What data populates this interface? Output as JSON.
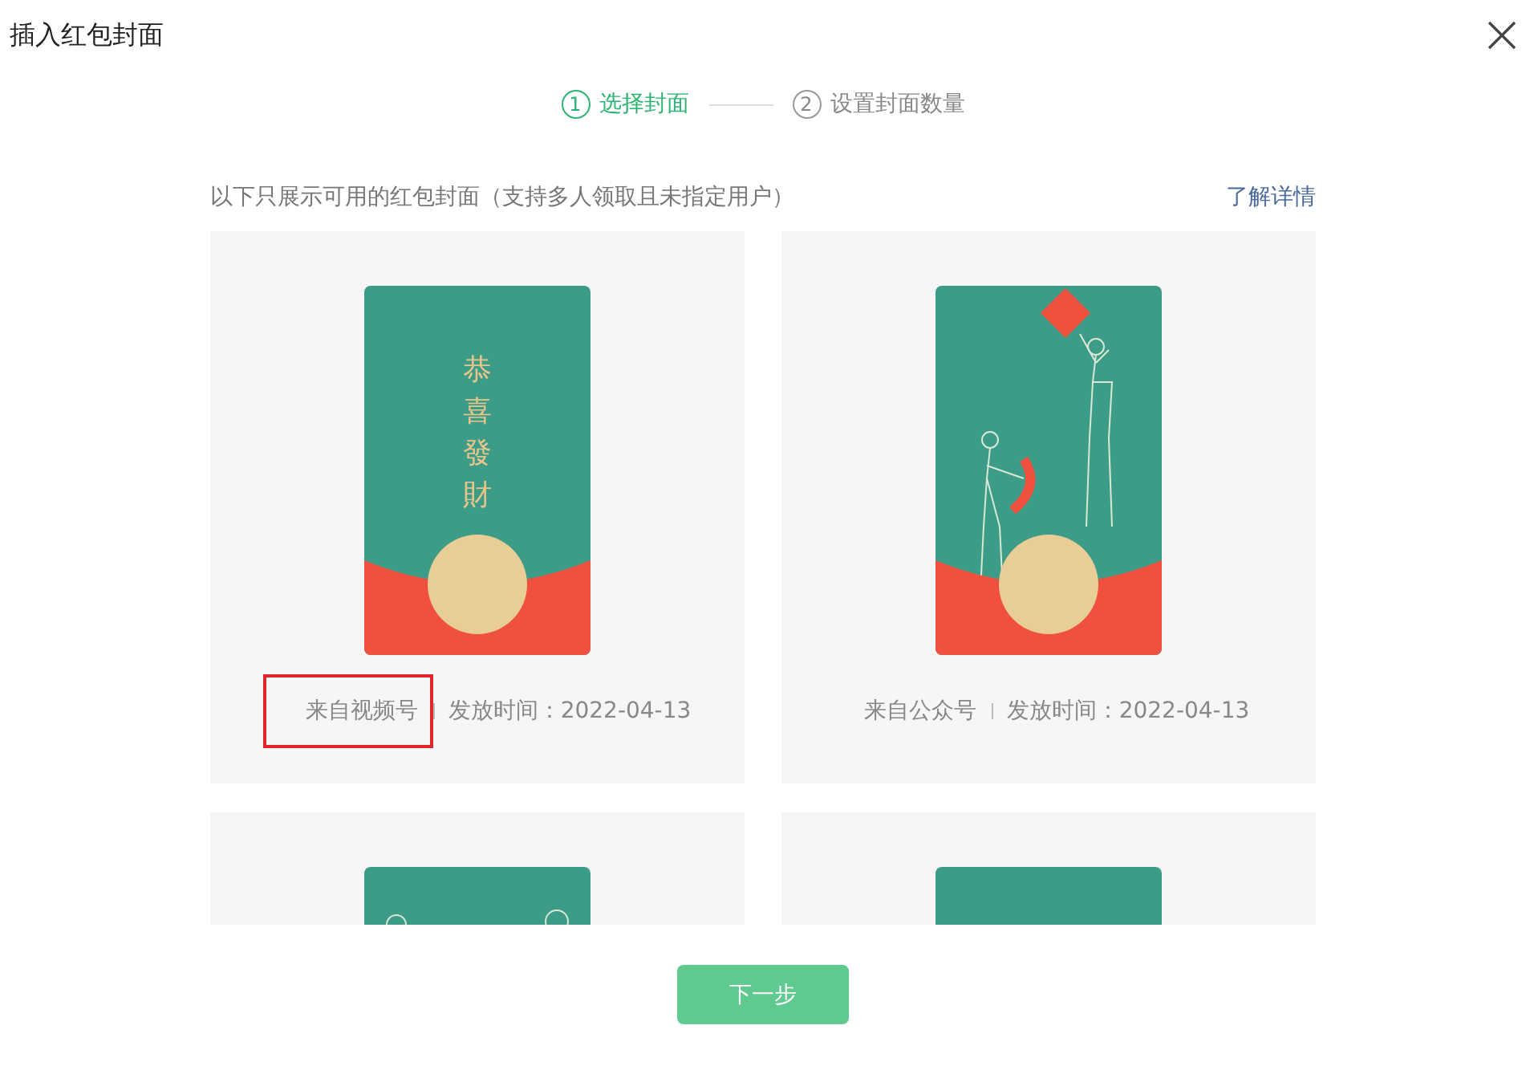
{
  "dialog": {
    "title": "插入红包封面"
  },
  "steps": [
    {
      "number": "1",
      "label": "选择封面",
      "selected": true
    },
    {
      "number": "2",
      "label": "设置封面数量",
      "selected": false
    }
  ],
  "notice": "以下只展示可用的红包封面（支持多人领取且未指定用户）",
  "learn_more": "了解详情",
  "covers": [
    {
      "kind": "greeting",
      "cover_text": "恭喜發財",
      "source": "来自视频号",
      "release": "发放时间：2022-04-13",
      "highlighted": true
    },
    {
      "kind": "figures",
      "source": "来自公众号",
      "release": "发放时间：2022-04-13",
      "highlighted": false
    },
    {
      "kind": "ornament"
    },
    {
      "kind": "plain"
    }
  ],
  "next_button": {
    "label": "下一步",
    "disabled": true
  }
}
